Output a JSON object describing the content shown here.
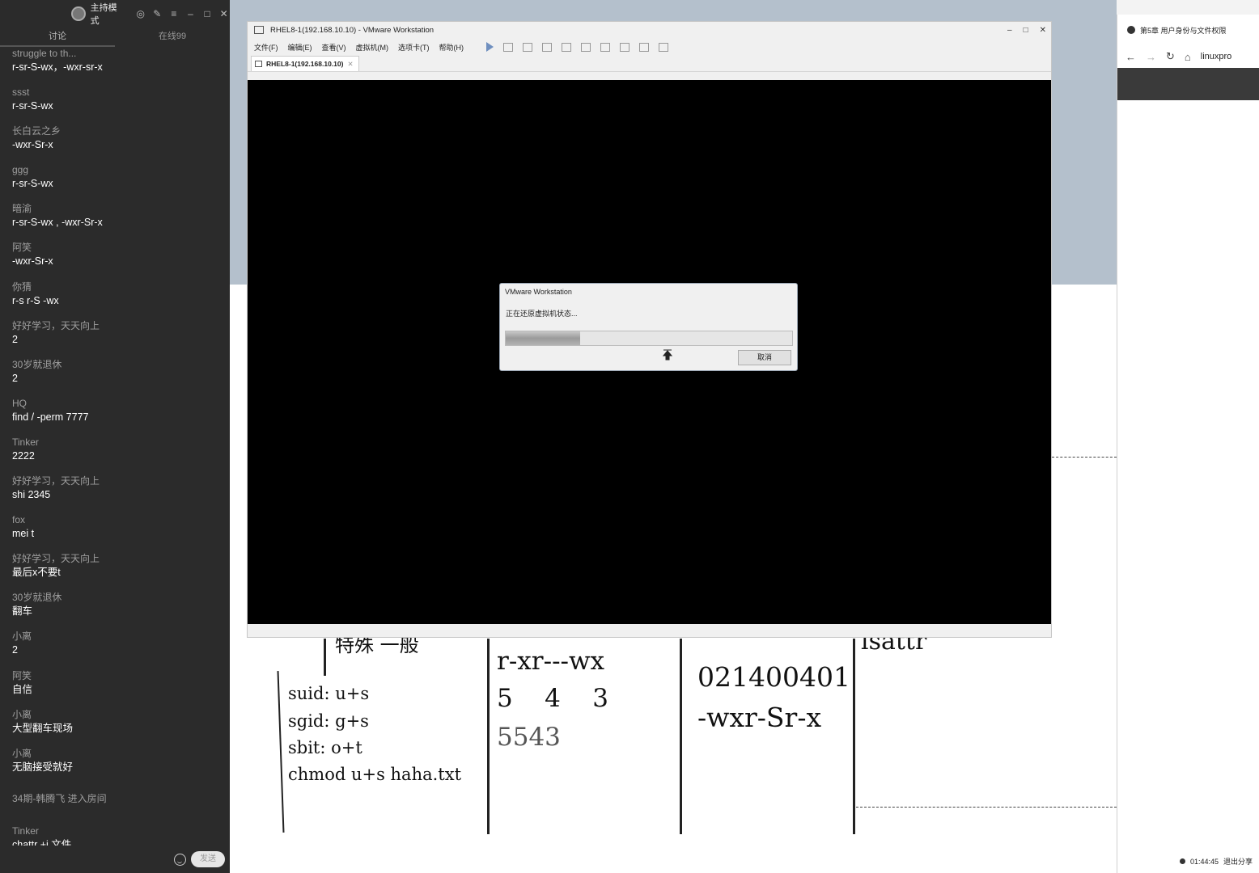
{
  "chat": {
    "mode_label": "主持模式",
    "tabs": [
      "讨论",
      "在线99"
    ],
    "messages": [
      {
        "who": "struggle to th...",
        "text": "r-sr-S-wx，-wxr-sr-x"
      },
      {
        "who": "ssst",
        "text": "r-sr-S-wx"
      },
      {
        "who": "长白云之乡",
        "text": "-wxr-Sr-x"
      },
      {
        "who": "ggg",
        "text": "r-sr-S-wx"
      },
      {
        "who": "暗渝",
        "text": "r-sr-S-wx , -wxr-Sr-x"
      },
      {
        "who": "阿笑",
        "text": "-wxr-Sr-x"
      },
      {
        "who": "你猜",
        "text": "r-s r-S -wx"
      },
      {
        "who": "好好学习，天天向上",
        "text": "2"
      },
      {
        "who": "30岁就退休",
        "text": "2"
      },
      {
        "who": "HQ",
        "text": "find / -perm 7777"
      },
      {
        "who": "Tinker",
        "text": "2222"
      },
      {
        "who": "好好学习，天天向上",
        "text": "shi 2345"
      },
      {
        "who": "fox",
        "text": "mei t"
      },
      {
        "who": "好好学习，天天向上",
        "text": "最后x不要t"
      },
      {
        "who": "30岁就退休",
        "text": "翻车"
      },
      {
        "who": "小离",
        "text": "2"
      },
      {
        "who": "阿笑",
        "text": "自信"
      },
      {
        "who": "小离",
        "text": "大型翻车现场"
      },
      {
        "who": "小离",
        "text": "无脑接受就好"
      },
      {
        "who": "34期-韩腾飞 进入房间",
        "text": ""
      },
      {
        "who": "Tinker",
        "text": "chattr +i 文件"
      }
    ],
    "send_label": "发送"
  },
  "vmware": {
    "window_title": "RHEL8-1(192.168.10.10) - VMware Workstation",
    "menu": [
      "文件(F)",
      "编辑(E)",
      "查看(V)",
      "虚拟机(M)",
      "选项卡(T)",
      "帮助(H)"
    ],
    "tab_label": "RHEL8-1(192.168.10.10)",
    "dialog": {
      "title": "VMware Workstation",
      "message": "正在还原虚拟机状态...",
      "progress": 0.26,
      "cancel_label": "取消"
    }
  },
  "whiteboard": {
    "col1": [
      "suid: u+s",
      "sgid: g+s",
      "sbit: o+t",
      "chmod u+s haha.txt"
    ],
    "col2": [
      "r-xr---wx",
      "5    4    3",
      "5543"
    ],
    "col3": [
      "021400401",
      "-wxr-Sr-x"
    ],
    "top_fragment": "lsattr",
    "left_fragment": "特殊 一般"
  },
  "browser": {
    "tab_title": "第5章 用户身份与文件权限",
    "url": "linuxpro",
    "time": "01:44:45",
    "exit_share": "退出分享"
  }
}
